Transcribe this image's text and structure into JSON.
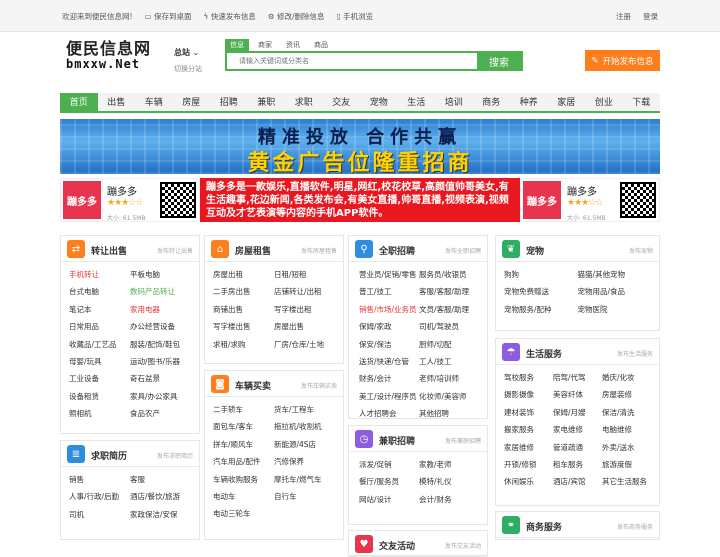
{
  "topbar": {
    "welcome": "欢迎来到便民信息网!",
    "save_desktop": "保存到桌面",
    "quick_post": "快速发布信息",
    "edit_delete": "修改/删除信息",
    "mobile": "手机浏览",
    "register": "注册",
    "login": "登录"
  },
  "logo": {
    "cn": "便民信息网",
    "en": "bmxxw.Net"
  },
  "city": {
    "name": "总站",
    "switch": "切换分站"
  },
  "search": {
    "tabs": [
      "信息",
      "商家",
      "资讯",
      "商品"
    ],
    "placeholder": "请输入关键词或分类名",
    "button": "搜索"
  },
  "post_button": "开始发布信息",
  "nav": [
    "首页",
    "出售",
    "车辆",
    "房屋",
    "招聘",
    "兼职",
    "求职",
    "交友",
    "宠物",
    "生活",
    "培训",
    "商务",
    "种养",
    "家居",
    "创业",
    "下载"
  ],
  "banner": {
    "line1": "精准投放  合作共赢",
    "line2": "黄金广告位隆重招商"
  },
  "ad": {
    "app_name": "蹦多多",
    "logo_text": "蹦多多",
    "stars": "★★★☆☆",
    "size": "大小: 61.5MB",
    "text": "蹦多多是一款娱乐,直播软件,明星,网红,校花校草,高颜值帅哥美女,有生活趣事,花边新闻,各类发布会,有美女直播,帅哥直播,视频表演,视频互动及才艺表演等内容的手机APP软件。"
  },
  "panels": {
    "sell": {
      "title": "转让出售",
      "link": "发布转让出售",
      "items": [
        "手机转让",
        "平板电脑",
        "台式电脑",
        "数码产品转让",
        "笔记本",
        "家用电器",
        "日常用品",
        "办公经营设备",
        "收藏品/工艺品",
        "服装/配饰/鞋包",
        "母婴/玩具",
        "运动/图书/乐器",
        "工业设备",
        "奇石盆景",
        "设备租赁",
        "家具/办公家具",
        "照相机",
        "食品农产"
      ]
    },
    "house": {
      "title": "房屋租售",
      "link": "发布房屋租售",
      "items": [
        "房屋出租",
        "日租/短租",
        "二手房出售",
        "店铺转让/出租",
        "商铺出售",
        "写字楼出租",
        "写字楼出售",
        "房屋出售",
        "求租/求购",
        "厂房/仓库/土地"
      ]
    },
    "job": {
      "title": "全职招聘",
      "link": "发布全职招聘",
      "items": [
        "营业员/促销/零售",
        "服务员/收银员",
        "普工/技工",
        "客服/客服/助理",
        "销售/市场/业务员",
        "文员/客服/助理",
        "保姆/家政",
        "司机/驾驶员",
        "保安/保洁",
        "厨师/切配",
        "送货/快递/仓管",
        "工人/技工",
        "财务/会计",
        "老师/培训师",
        "美工/设计/程序员",
        "化妆师/美容师",
        "人才招聘会",
        "其他招聘"
      ]
    },
    "pet": {
      "title": "宠物",
      "link": "发布宠物",
      "items": [
        "狗狗",
        "猫猫/其他宠物",
        "宠物免费赠送",
        "宠物用品/食品",
        "宠物服务/配种",
        "宠物医院"
      ]
    },
    "car": {
      "title": "车辆买卖",
      "link": "发布车辆买卖",
      "items": [
        "二手轿车",
        "货车/工程车",
        "面包车/客车",
        "拖拉机/收割机",
        "拼车/顺风车",
        "新能源/4S店",
        "汽车用品/配件",
        "汽修保养",
        "车辆收购服务",
        "摩托车/燃气车",
        "电动车",
        "自行车",
        "电动三轮车"
      ]
    },
    "life": {
      "title": "生活服务",
      "link": "发布生活服务",
      "items": [
        "驾校服务",
        "陪驾/代驾",
        "婚庆/化妆",
        "摄影摄像",
        "美容纤体",
        "房屋装修",
        "建材装饰",
        "保姆/月嫂",
        "保洁/清洗",
        "搬家服务",
        "家电维修",
        "电脑维修",
        "家居维修",
        "管道疏通",
        "外卖/送水",
        "开锁/修锁",
        "租车服务",
        "旅游度假",
        "休闲娱乐",
        "酒店/宾馆",
        "其它生活服务"
      ]
    },
    "resume": {
      "title": "求职简历",
      "link": "发布求职简历",
      "items": [
        "销售",
        "客服",
        "人事/行政/后勤",
        "酒店/餐饮/旅游",
        "司机",
        "家政保洁/安保"
      ]
    },
    "parttime": {
      "title": "兼职招聘",
      "link": "发布兼职招聘",
      "items": [
        "派发/促销",
        "家教/老师",
        "餐厅/服务员",
        "模特/礼仪",
        "网站/设计",
        "会计/财务"
      ]
    },
    "friend": {
      "title": "交友活动",
      "link": "发布交友活动"
    },
    "biz": {
      "title": "商务服务",
      "link": "发布商务服务"
    }
  }
}
